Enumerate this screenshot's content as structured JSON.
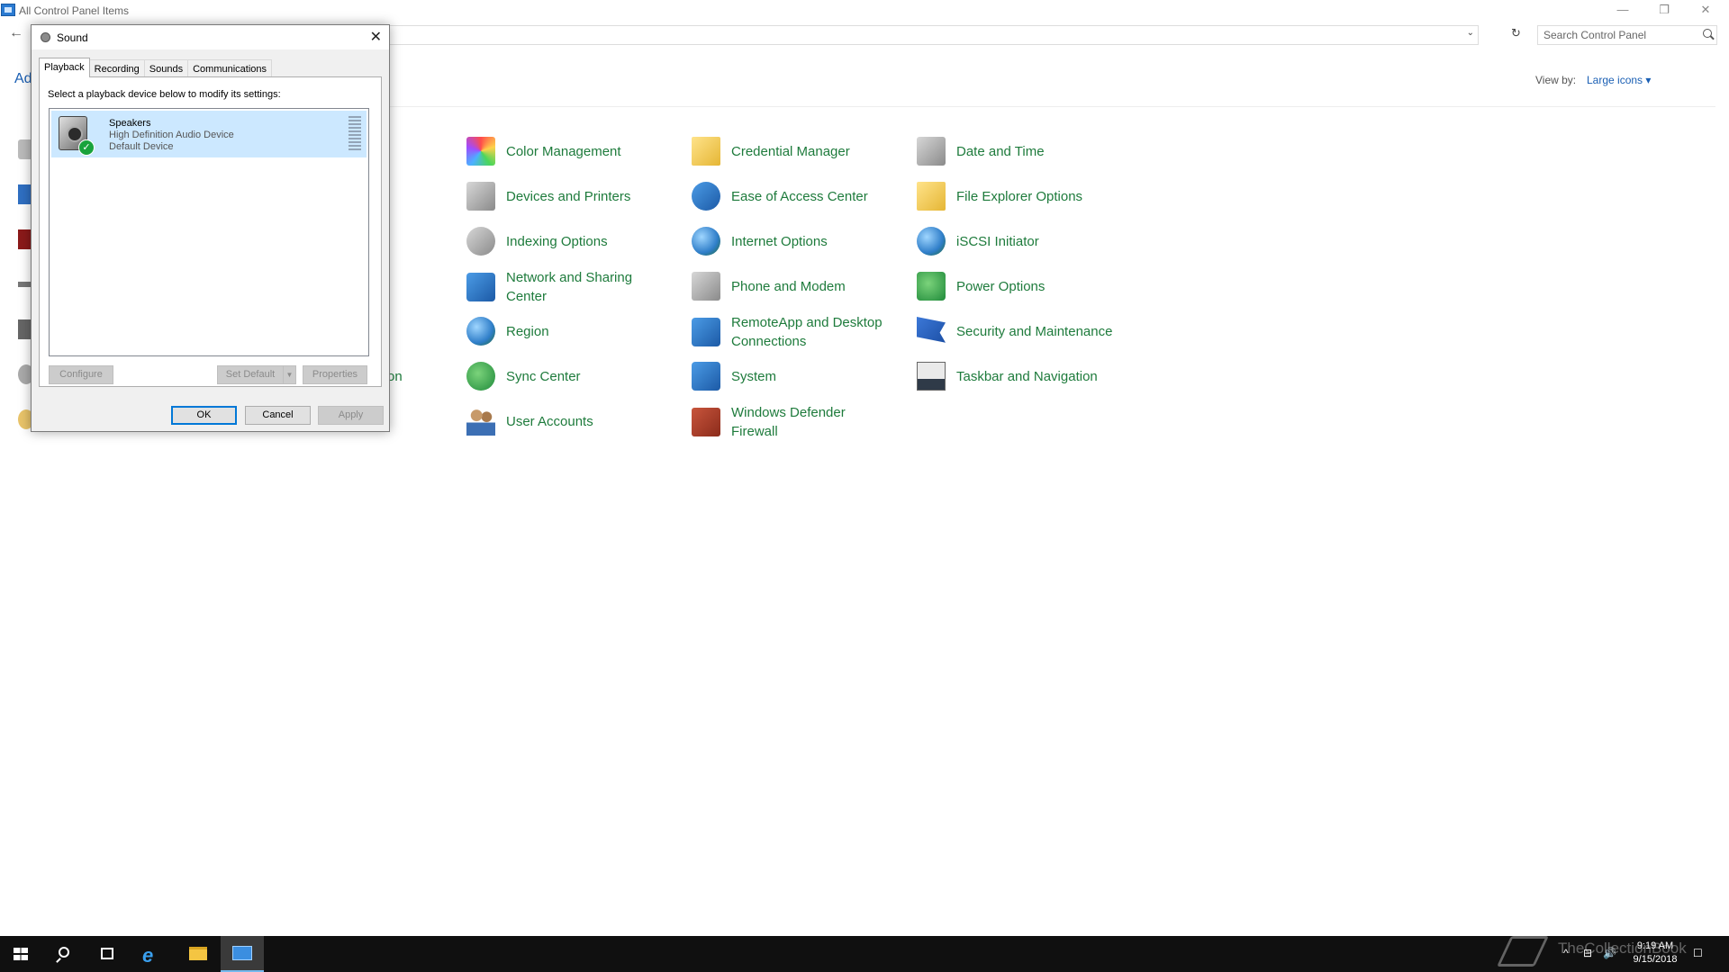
{
  "window": {
    "title": "All Control Panel Items",
    "minimize": "—",
    "restore": "❐",
    "close": "✕"
  },
  "nav": {
    "back": "←",
    "dropdown": "⌄",
    "refresh": "↻",
    "search_placeholder": "Search Control Panel"
  },
  "header": {
    "adjust_text": "Ad",
    "view_by_label": "View by:",
    "view_by_value": "Large icons"
  },
  "control_panel": {
    "items": [
      {
        "label": "Color Management",
        "icon": "color-management-icon"
      },
      {
        "label": "Credential Manager",
        "icon": "credential-manager-icon"
      },
      {
        "label": "Date and Time",
        "icon": "date-time-icon"
      },
      {
        "label": "Devices and Printers",
        "icon": "devices-printers-icon"
      },
      {
        "label": "Ease of Access Center",
        "icon": "ease-of-access-icon"
      },
      {
        "label": "File Explorer Options",
        "icon": "file-explorer-options-icon"
      },
      {
        "label": "Indexing Options",
        "icon": "indexing-options-icon"
      },
      {
        "label": "Internet Options",
        "icon": "internet-options-icon"
      },
      {
        "label": "iSCSI Initiator",
        "icon": "iscsi-initiator-icon"
      },
      {
        "label": "Network and Sharing Center",
        "icon": "network-sharing-icon"
      },
      {
        "label": "Phone and Modem",
        "icon": "phone-modem-icon"
      },
      {
        "label": "Power Options",
        "icon": "power-options-icon"
      },
      {
        "label": "Region",
        "icon": "region-icon"
      },
      {
        "label": "RemoteApp and Desktop Connections",
        "icon": "remoteapp-icon"
      },
      {
        "label": "Security and Maintenance",
        "icon": "security-maintenance-icon"
      },
      {
        "label": "Sync Center",
        "icon": "sync-center-icon"
      },
      {
        "label": "System",
        "icon": "system-icon"
      },
      {
        "label": "Taskbar and Navigation",
        "icon": "taskbar-navigation-icon"
      },
      {
        "label": "User Accounts",
        "icon": "user-accounts-icon"
      },
      {
        "label": "Windows Defender Firewall",
        "icon": "firewall-icon"
      }
    ],
    "partial_label": "on"
  },
  "sound_dialog": {
    "title": "Sound",
    "close": "✕",
    "tabs": [
      "Playback",
      "Recording",
      "Sounds",
      "Communications"
    ],
    "active_tab": "Playback",
    "instruction": "Select a playback device below to modify its settings:",
    "device": {
      "name": "Speakers",
      "description": "High Definition Audio Device",
      "status": "Default Device",
      "check": "✓"
    },
    "buttons": {
      "configure": "Configure",
      "set_default": "Set Default",
      "set_default_arrow": "▼",
      "properties": "Properties",
      "ok": "OK",
      "cancel": "Cancel",
      "apply": "Apply"
    }
  },
  "taskbar": {
    "ie_glyph": "e",
    "tray_chevron": "^",
    "tray_network": "⊟",
    "tray_volume": "🔊",
    "tray_notification": "☐",
    "time": "9:19 AM",
    "date": "9/15/2018",
    "watermark": "TheCollectionBook"
  }
}
